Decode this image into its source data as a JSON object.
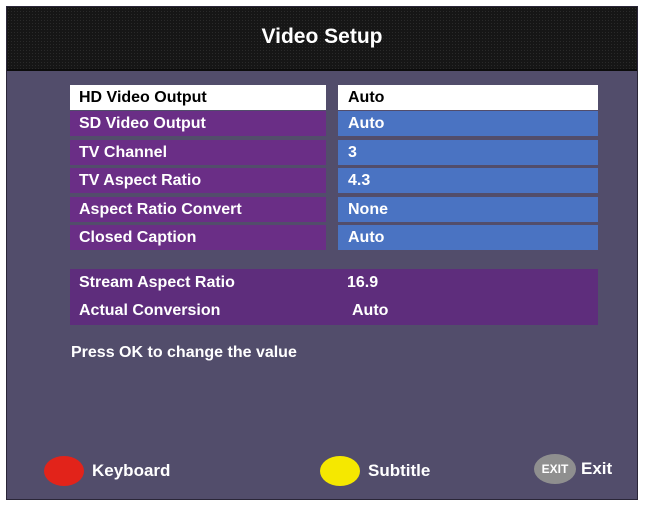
{
  "title": "Video Setup",
  "settings": [
    {
      "label": "HD Video Output",
      "value": "Auto"
    },
    {
      "label": "SD Video Output",
      "value": "Auto"
    },
    {
      "label": "TV Channel",
      "value": "3"
    },
    {
      "label": "TV Aspect Ratio",
      "value": "4.3"
    },
    {
      "label": "Aspect Ratio Convert",
      "value": "None"
    },
    {
      "label": "Closed Caption",
      "value": "Auto"
    }
  ],
  "info": {
    "stream_label": "Stream Aspect Ratio",
    "stream_value": "16.9",
    "conversion_label": "Actual Conversion",
    "conversion_value": "Auto"
  },
  "hint": "Press OK to change the value",
  "footer": {
    "keyboard_label": "Keyboard",
    "subtitle_label": "Subtitle",
    "exit_badge": "EXIT",
    "exit_label": "Exit"
  },
  "colors": {
    "red": "#e2231a",
    "yellow": "#f5e800"
  }
}
